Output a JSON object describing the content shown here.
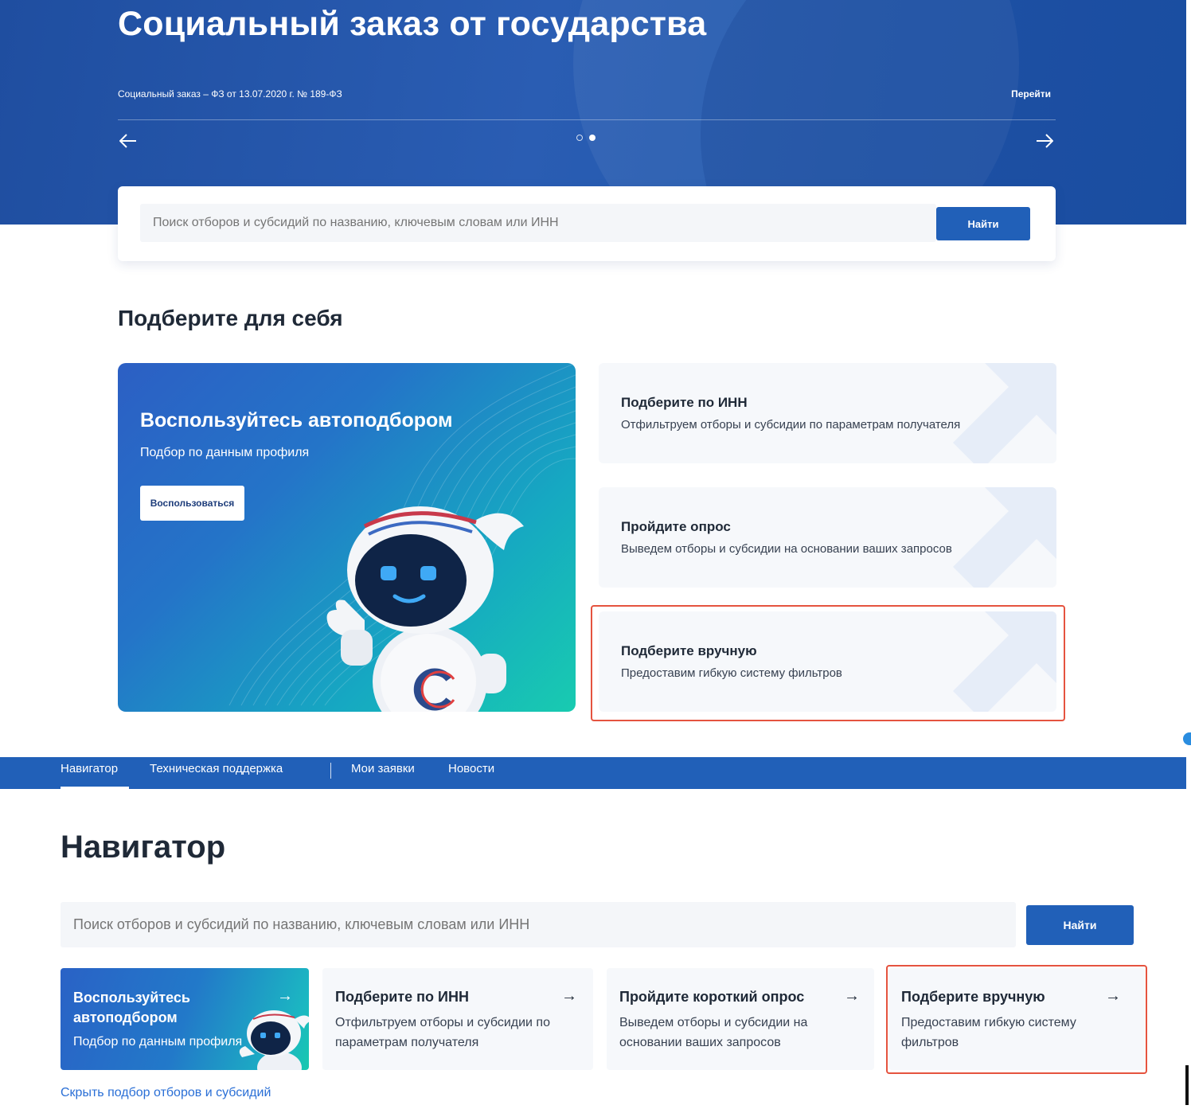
{
  "hero": {
    "title": "Социальный заказ от государства",
    "subtitle": "Социальный заказ – ФЗ от 13.07.2020 г. № 189-ФЗ",
    "link": "Перейти",
    "prev_icon": "arrow-left-icon",
    "next_icon": "arrow-right-icon",
    "slides_total": 2,
    "slide_active": 2
  },
  "top_search": {
    "placeholder": "Поиск отборов и субсидий по названию, ключевым словам или ИНН",
    "button": "Найти"
  },
  "pick": {
    "title": "Подберите для себя",
    "promo": {
      "title": "Воспользуйтесь автоподбором",
      "subtitle": "Подбор по данным профиля",
      "button": "Воспользоваться"
    },
    "options": [
      {
        "title": "Подберите по ИНН",
        "desc": "Отфильтруем отборы и субсидии по параметрам получателя"
      },
      {
        "title": "Пройдите опрос",
        "desc": "Выведем отборы и субсидии на основании ваших запросов"
      },
      {
        "title": "Подберите вручную",
        "desc": "Предоставим гибкую систему фильтров"
      }
    ]
  },
  "nav": {
    "items": [
      "Навигатор",
      "Техническая поддержка",
      "Мои заявки",
      "Новости"
    ],
    "active": "Навигатор"
  },
  "navigator": {
    "title": "Навигатор",
    "search_placeholder": "Поиск отборов и субсидий по названию, ключевым словам или ИНН",
    "search_button": "Найти",
    "cards": [
      {
        "title": "Воспользуйтесь автоподбором",
        "desc": "Подбор по данным профиля"
      },
      {
        "title": "Подберите по ИНН",
        "desc": "Отфильтруем отборы и субсидии по параметрам получателя"
      },
      {
        "title": "Пройдите короткий опрос",
        "desc": "Выведем отборы и субсидии на основании ваших запросов"
      },
      {
        "title": "Подберите вручную",
        "desc": "Предоставим гибкую систему фильтров"
      }
    ],
    "hide_link": "Скрыть подбор отборов и субсидий"
  },
  "colors": {
    "brand_blue": "#2160b8",
    "highlight": "#e5533f",
    "link": "#2a6fd6"
  }
}
